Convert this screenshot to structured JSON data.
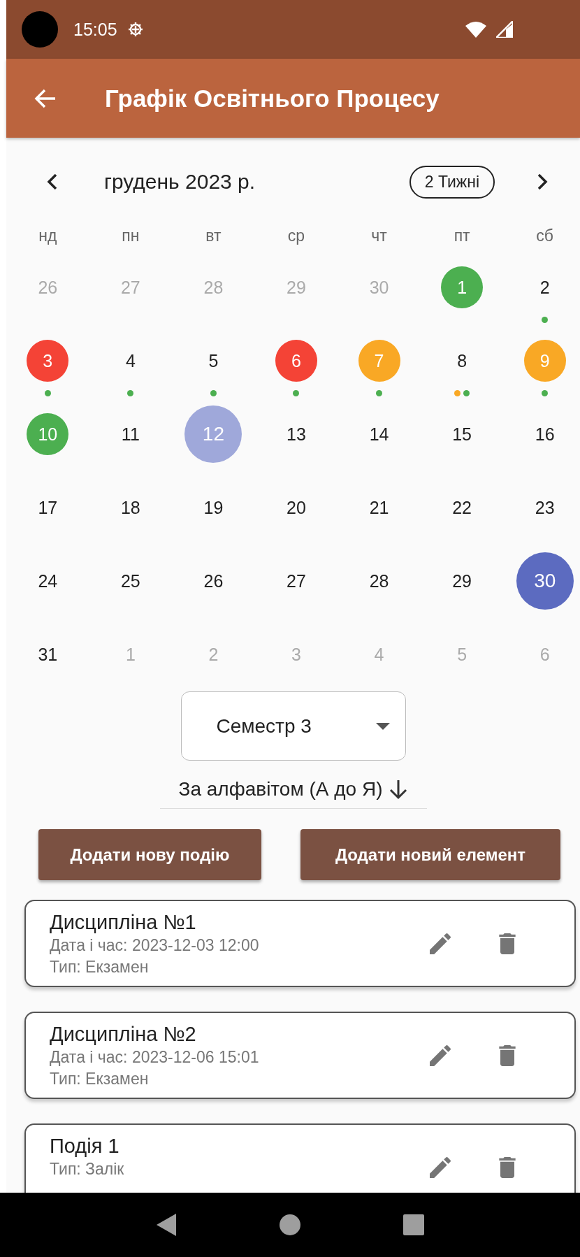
{
  "status_bar": {
    "time": "15:05"
  },
  "app_bar": {
    "title": "Графік Освітнього Процесу"
  },
  "calendar": {
    "month": "грудень 2023 р.",
    "format_button": "2 Тижні",
    "weekdays": [
      "нд",
      "пн",
      "вт",
      "ср",
      "чт",
      "пт",
      "сб"
    ],
    "days": [
      {
        "day": "26",
        "outside": true,
        "selected": false,
        "today": false
      },
      {
        "day": "27",
        "outside": true,
        "selected": false,
        "today": false
      },
      {
        "day": "28",
        "outside": true,
        "selected": false,
        "today": false
      },
      {
        "day": "29",
        "outside": true,
        "selected": false,
        "today": false
      },
      {
        "day": "30",
        "outside": true,
        "selected": false,
        "today": false
      },
      {
        "day": "1",
        "outside": false,
        "selected": false,
        "today": false,
        "color": "#4caf50"
      },
      {
        "day": "2",
        "outside": false,
        "selected": false,
        "today": false,
        "dots": [
          {
            "color": "#4caf50"
          }
        ]
      },
      {
        "day": "3",
        "outside": false,
        "selected": false,
        "today": false,
        "color": "#f44336",
        "dots": [
          {
            "color": "#4caf50"
          }
        ]
      },
      {
        "day": "4",
        "outside": false,
        "selected": false,
        "today": false,
        "dots": [
          {
            "color": "#4caf50"
          }
        ]
      },
      {
        "day": "5",
        "outside": false,
        "selected": false,
        "today": false,
        "dots": [
          {
            "color": "#4caf50"
          }
        ]
      },
      {
        "day": "6",
        "outside": false,
        "selected": false,
        "today": false,
        "color": "#f44336",
        "dots": [
          {
            "color": "#4caf50"
          }
        ]
      },
      {
        "day": "7",
        "outside": false,
        "selected": false,
        "today": false,
        "color": "#f9a825",
        "dots": [
          {
            "color": "#4caf50"
          }
        ]
      },
      {
        "day": "8",
        "outside": false,
        "selected": false,
        "today": false,
        "dots": [
          {
            "color": "#f9a825"
          },
          {
            "color": "#4caf50"
          }
        ]
      },
      {
        "day": "9",
        "outside": false,
        "selected": false,
        "today": false,
        "color": "#f9a825",
        "dots": [
          {
            "color": "#4caf50"
          }
        ]
      },
      {
        "day": "10",
        "outside": false,
        "selected": false,
        "today": false,
        "color": "#4caf50"
      },
      {
        "day": "11",
        "outside": false,
        "selected": false,
        "today": false
      },
      {
        "day": "12",
        "outside": false,
        "selected": false,
        "today": true
      },
      {
        "day": "13",
        "outside": false,
        "selected": false,
        "today": false
      },
      {
        "day": "14",
        "outside": false,
        "selected": false,
        "today": false
      },
      {
        "day": "15",
        "outside": false,
        "selected": false,
        "today": false
      },
      {
        "day": "16",
        "outside": false,
        "selected": false,
        "today": false
      },
      {
        "day": "17",
        "outside": false,
        "selected": false,
        "today": false
      },
      {
        "day": "18",
        "outside": false,
        "selected": false,
        "today": false
      },
      {
        "day": "19",
        "outside": false,
        "selected": false,
        "today": false
      },
      {
        "day": "20",
        "outside": false,
        "selected": false,
        "today": false
      },
      {
        "day": "21",
        "outside": false,
        "selected": false,
        "today": false
      },
      {
        "day": "22",
        "outside": false,
        "selected": false,
        "today": false
      },
      {
        "day": "23",
        "outside": false,
        "selected": false,
        "today": false
      },
      {
        "day": "24",
        "outside": false,
        "selected": false,
        "today": false
      },
      {
        "day": "25",
        "outside": false,
        "selected": false,
        "today": false
      },
      {
        "day": "26",
        "outside": false,
        "selected": false,
        "today": false
      },
      {
        "day": "27",
        "outside": false,
        "selected": false,
        "today": false
      },
      {
        "day": "28",
        "outside": false,
        "selected": false,
        "today": false
      },
      {
        "day": "29",
        "outside": false,
        "selected": false,
        "today": false
      },
      {
        "day": "30",
        "outside": false,
        "selected": true,
        "today": false
      },
      {
        "day": "31",
        "outside": false,
        "selected": false,
        "today": false
      },
      {
        "day": "1",
        "outside": true,
        "selected": false,
        "today": false
      },
      {
        "day": "2",
        "outside": true,
        "selected": false,
        "today": false
      },
      {
        "day": "3",
        "outside": true,
        "selected": false,
        "today": false
      },
      {
        "day": "4",
        "outside": true,
        "selected": false,
        "today": false
      },
      {
        "day": "5",
        "outside": true,
        "selected": false,
        "today": false
      },
      {
        "day": "6",
        "outside": true,
        "selected": false,
        "today": false
      }
    ]
  },
  "semester_dropdown": {
    "value": "Семестр 3"
  },
  "sort": {
    "label": "За алфавітом (А до Я)"
  },
  "buttons": [
    "Додати нову подію",
    "Додати новий елемент"
  ],
  "events": [
    {
      "title": "Дисципліна №1",
      "lines": [
        "Дата і час: 2023-12-03 12:00",
        "Тип: Екзамен"
      ]
    },
    {
      "title": "Дисципліна №2",
      "lines": [
        "Дата і час: 2023-12-06 15:01",
        "Тип: Екзамен"
      ]
    },
    {
      "title": "Подія 1",
      "lines": [
        "Тип: Залік"
      ]
    }
  ]
}
